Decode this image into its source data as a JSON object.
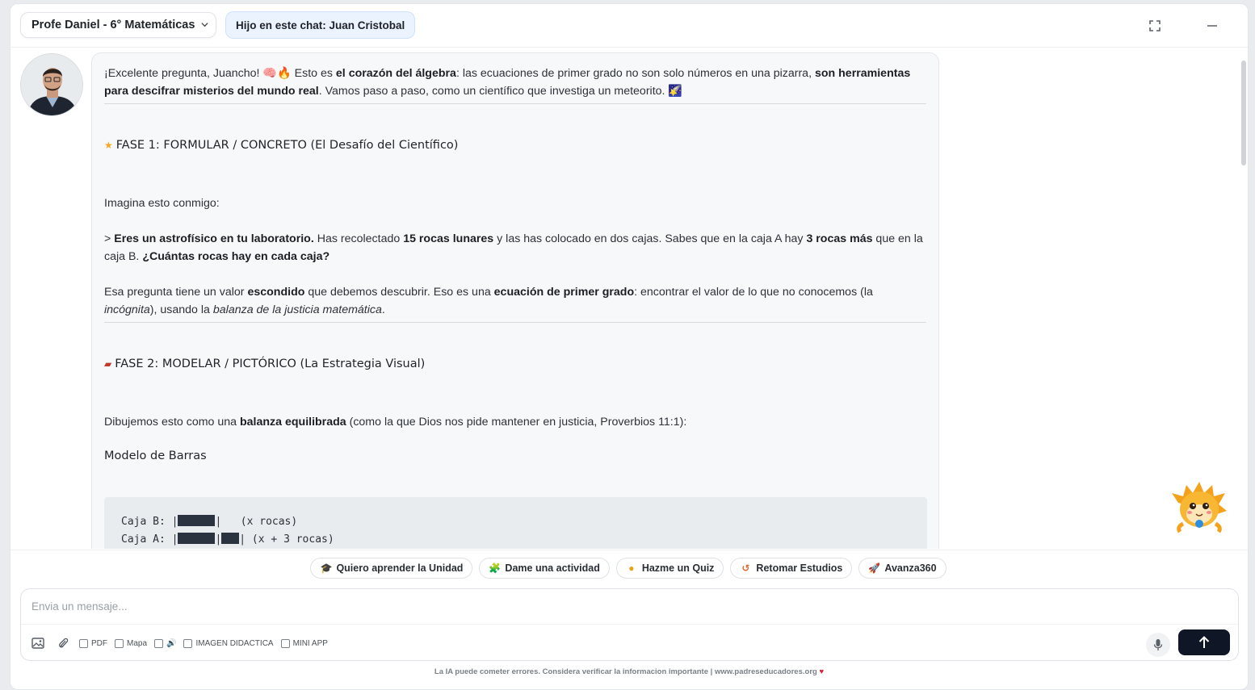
{
  "header": {
    "course_select": "Profe Daniel - 6° Matemáticas",
    "child_chip": "Hijo en este chat: Juan Cristobal"
  },
  "message": {
    "intro": {
      "p1": "¡Excelente pregunta, Juancho! 🧠🔥 Esto es ",
      "b1": "el corazón del álgebra",
      "p2": ": las ecuaciones de primer grado no son solo números en una pizarra, ",
      "b2": "son herramientas para descifrar misterios del mundo real",
      "p3": ". Vamos paso a paso, como un científico que investiga un meteorito. 🌠"
    },
    "phase1_title": "FASE 1: FORMULAR / CONCRETO (El Desafío del Científico)",
    "imagine": "Imagina esto conmigo:",
    "quote": {
      "p0": "> ",
      "b1": "Eres un astrofísico en tu laboratorio.",
      "p1": " Has recolectado ",
      "b2": "15 rocas lunares",
      "p2": " y las has colocado en dos cajas. Sabes que en la caja A hay ",
      "b3": "3 rocas más",
      "p3": " que en la caja B. ",
      "b4": "¿Cuántas rocas hay en cada caja?"
    },
    "explain": {
      "p1": "Esa pregunta tiene un valor ",
      "b1": "escondido",
      "p2": " que debemos descubrir. Eso es una ",
      "b2": "ecuación de primer grado",
      "p3": ": encontrar el valor de lo que no conocemos (la ",
      "i1": "incógnita",
      "p4": "), usando la ",
      "i2": "balanza de la justicia matemática",
      "p5": "."
    },
    "phase2_title": "FASE 2: MODELAR / PICTÓRICO (La Estrategia Visual)",
    "draw": {
      "p1": "Dibujemos esto como una ",
      "b1": "balanza equilibrada",
      "p2": " (como la que Dios nos pide mantener en justicia, Proverbios 11:1):"
    },
    "bar_model_title": "Modelo de Barras",
    "code": {
      "line1_label": "Caja B: |",
      "line1_tail": "|   (x rocas)",
      "line2_label": "Caja A: |",
      "line2_mid": "|",
      "line2_tail": "| (x + 3 rocas)"
    }
  },
  "quick_actions": [
    {
      "icon": "graduation-cap-icon",
      "label": "Quiero aprender la Unidad"
    },
    {
      "icon": "puzzle-icon",
      "label": "Dame una actividad"
    },
    {
      "icon": "brain-icon",
      "label": "Hazme un Quiz"
    },
    {
      "icon": "undo-icon",
      "label": "Retomar Estudios"
    },
    {
      "icon": "rocket-icon",
      "label": "Avanza360"
    }
  ],
  "composer": {
    "placeholder": "Envia un mensaje...",
    "options": [
      "PDF",
      "Mapa",
      "🔊",
      "IMAGEN DIDACTICA",
      "MINI APP"
    ]
  },
  "footer": {
    "disclaimer": "La IA puede cometer errores. Considera verificar la informacion importante | www.padreseducadores.org",
    "heart": "♥"
  },
  "colors": {
    "send_button": "#0f1726",
    "chip_bg": "#eaf3ff",
    "bubble_bg": "#f7f8fa"
  }
}
